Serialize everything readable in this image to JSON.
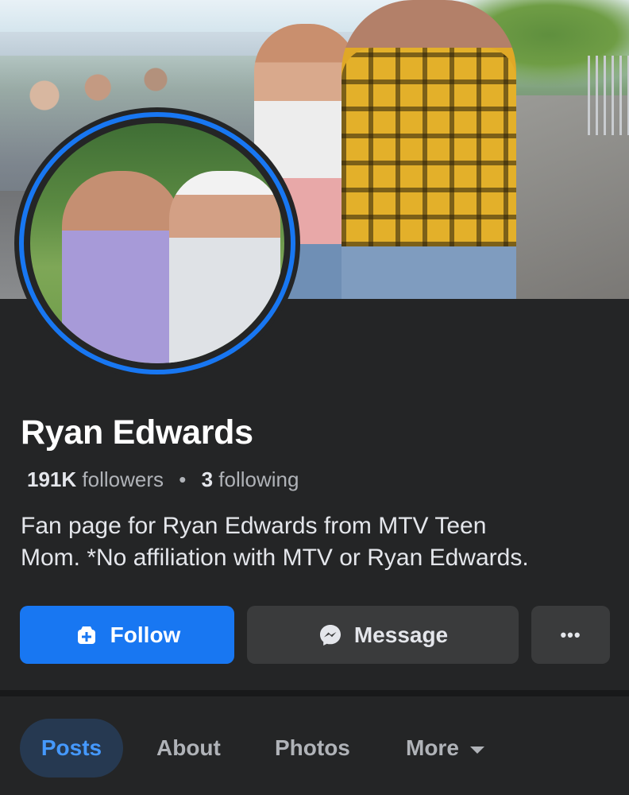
{
  "profile": {
    "name": "Ryan Edwards",
    "followers_count": "191K",
    "followers_label": "followers",
    "following_count": "3",
    "following_label": "following",
    "separator": "•",
    "bio_line1": "Fan page for Ryan Edwards from MTV Teen",
    "bio_line2": "Mom. *No affiliation with MTV or Ryan Edwards."
  },
  "actions": {
    "follow_label": "Follow",
    "message_label": "Message",
    "more_label": "•••"
  },
  "tabs": [
    {
      "label": "Posts",
      "active": true
    },
    {
      "label": "About",
      "active": false
    },
    {
      "label": "Photos",
      "active": false
    },
    {
      "label": "More",
      "active": false
    }
  ],
  "colors": {
    "background": "#242526",
    "accent": "#1877f2",
    "active_tab_bg": "#263951",
    "active_tab_text": "#4599ff",
    "secondary_button": "#3a3b3c"
  },
  "icons": {
    "follow": "follow-plus-icon",
    "message": "messenger-icon",
    "more_tab": "caret-down-icon"
  }
}
